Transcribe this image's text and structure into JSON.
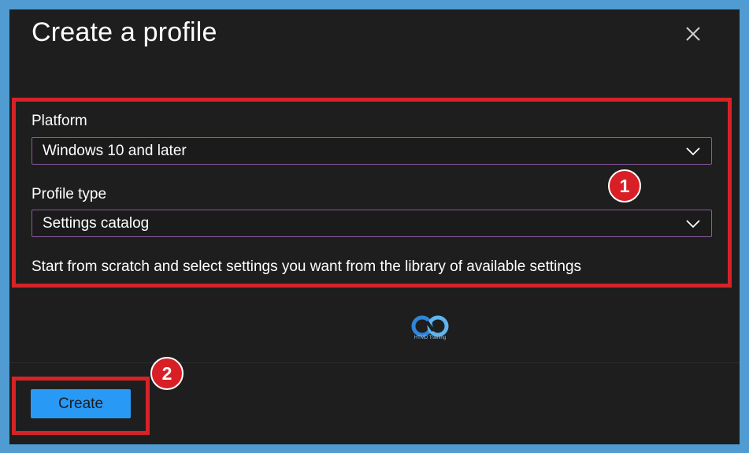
{
  "dialog": {
    "title": "Create a profile"
  },
  "form": {
    "platform_label": "Platform",
    "platform_value": "Windows 10 and later",
    "profile_type_label": "Profile type",
    "profile_type_value": "Settings catalog",
    "description": "Start from scratch and select settings you want from the library of available settings"
  },
  "annotations": {
    "badge_1": "1",
    "badge_2": "2"
  },
  "watermark": {
    "text": "HTMD Training"
  },
  "footer": {
    "create_label": "Create"
  },
  "icons": {
    "close": "close-icon",
    "dropdown": "chevron-down-icon",
    "logo": "htmd-logo-icon"
  },
  "colors": {
    "accent": "#2899f5",
    "highlight": "#d62328",
    "background": "#1e1e1e"
  }
}
